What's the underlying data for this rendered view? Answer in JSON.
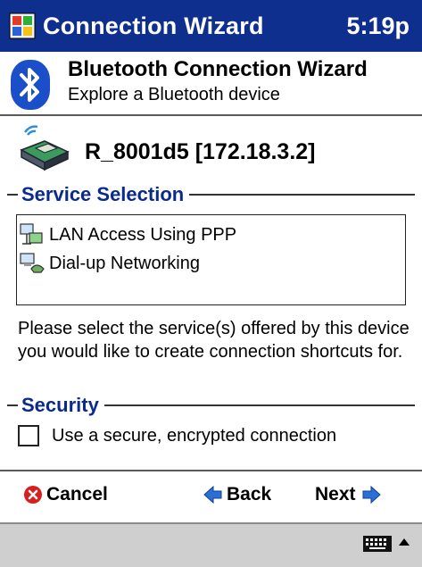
{
  "titlebar": {
    "title": "Connection Wizard",
    "time": "5:19p"
  },
  "header": {
    "title": "Bluetooth Connection Wizard",
    "subtitle": "Explore a Bluetooth device"
  },
  "device": {
    "name": "R_8001d5 [172.18.3.2]"
  },
  "service_section": {
    "label": "Service Selection",
    "items": [
      {
        "label": "LAN Access Using PPP",
        "icon": "lan-access-icon"
      },
      {
        "label": "Dial-up Networking",
        "icon": "dialup-icon"
      }
    ]
  },
  "instructions": "Please select the service(s) offered by this device you would like to create connection shortcuts for.",
  "security_section": {
    "label": "Security",
    "checkbox_label": "Use a secure, encrypted connection",
    "checked": false
  },
  "commands": {
    "cancel": "Cancel",
    "back": "Back",
    "next": "Next"
  },
  "icons": {
    "title": "windows-flag-icon",
    "header": "bluetooth-icon",
    "device": "wireless-device-icon",
    "cancel": "cancel-icon",
    "back": "back-arrow-icon",
    "next": "next-arrow-icon",
    "sip": "keyboard-icon"
  },
  "colors": {
    "titlebar": "#0e2f8e",
    "section_label": "#0a2b8c",
    "menubar": "#cfcfcf",
    "cancel_icon": "#d62020",
    "arrow_icon": "#2a6fd6"
  }
}
